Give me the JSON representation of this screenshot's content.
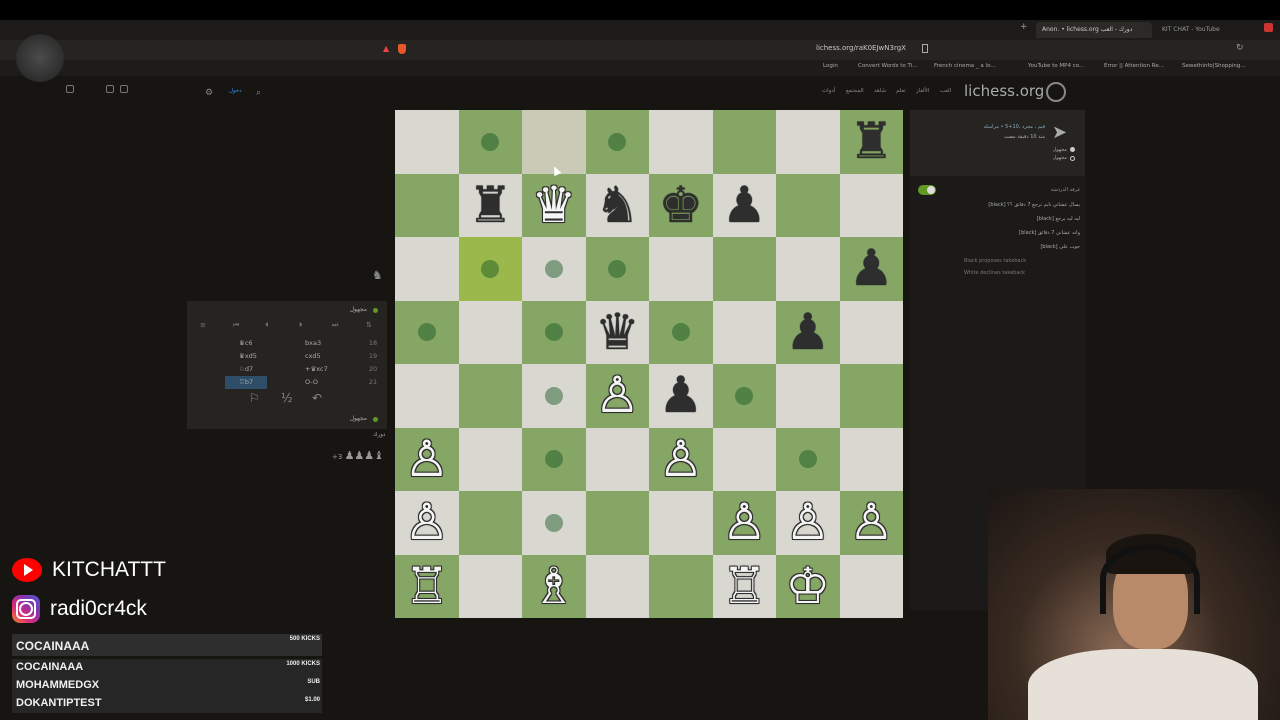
{
  "browser": {
    "tabs": [
      {
        "label": "Anon. • lichess.org دورك - العب",
        "active": true
      },
      {
        "label": "KIT CHAT - YouTube",
        "active": false
      }
    ],
    "url": "lichess.org/raK0EJwN3rgX",
    "bookmarks": [
      "Login",
      "Convert Words to Ti...",
      "French cinema _ a lo...",
      "YouTube to MP4 co...",
      "Error || Attention Re...",
      "Sewethinfo|Shopping..."
    ]
  },
  "lichess": {
    "logo": "lichess.org",
    "nav": [
      "العب",
      "الألغاز",
      "تعلم",
      "شاهد",
      "المجتمع",
      "أدوات"
    ],
    "signin": "دخول"
  },
  "board": {
    "pieces": [
      {
        "sq": "h8",
        "glyph": "♜",
        "color": "black"
      },
      {
        "sq": "b7",
        "glyph": "♜",
        "color": "black"
      },
      {
        "sq": "c7",
        "glyph": "♛",
        "color": "white"
      },
      {
        "sq": "d7",
        "glyph": "♞",
        "color": "black"
      },
      {
        "sq": "e7",
        "glyph": "♚",
        "color": "black"
      },
      {
        "sq": "f7",
        "glyph": "♟",
        "color": "black"
      },
      {
        "sq": "h6",
        "glyph": "♟",
        "color": "black"
      },
      {
        "sq": "d5",
        "glyph": "♛",
        "color": "black"
      },
      {
        "sq": "g5",
        "glyph": "♟",
        "color": "black"
      },
      {
        "sq": "d4",
        "glyph": "♙",
        "color": "white"
      },
      {
        "sq": "e4",
        "glyph": "♟",
        "color": "black"
      },
      {
        "sq": "a3",
        "glyph": "♙",
        "color": "white"
      },
      {
        "sq": "e3",
        "glyph": "♙",
        "color": "white"
      },
      {
        "sq": "a2",
        "glyph": "♙",
        "color": "white"
      },
      {
        "sq": "f2",
        "glyph": "♙",
        "color": "white"
      },
      {
        "sq": "g2",
        "glyph": "♙",
        "color": "white"
      },
      {
        "sq": "h2",
        "glyph": "♙",
        "color": "white"
      },
      {
        "sq": "a1",
        "glyph": "♖",
        "color": "white"
      },
      {
        "sq": "c1",
        "glyph": "♗",
        "color": "white"
      },
      {
        "sq": "f1",
        "glyph": "♖",
        "color": "white"
      },
      {
        "sq": "g1",
        "glyph": "♔",
        "color": "white"
      }
    ],
    "dots": [
      "b8",
      "d8",
      "b6",
      "c6",
      "d6",
      "a5",
      "c5",
      "e5",
      "c4",
      "f4",
      "c3",
      "g3",
      "c2"
    ],
    "last_move": [
      "c8",
      "b6"
    ]
  },
  "move_panel": {
    "top_player": "مجهول",
    "bottom_player": "مجهول",
    "bottom_status": "دورك",
    "material": "+3",
    "material_icons": "♟♟♟♝",
    "moves": [
      {
        "num": "18",
        "black": "bxa3",
        "white": "♛c6"
      },
      {
        "num": "19",
        "black": "cxd5",
        "white": "♛xd5"
      },
      {
        "num": "20",
        "black": "+♛xc7",
        "white": "♘d7"
      },
      {
        "num": "21",
        "black": "O-O",
        "white": "♖b7"
      }
    ],
    "half_label": "½"
  },
  "chat": {
    "game_type": "قيم ، مجرد ،10+5 • مراسلة",
    "game_time": "منذ 10 دقيقة مضت",
    "player_white": "مجهول",
    "player_black": "مجهول",
    "room_label": "غرفة الدردشة",
    "messages": [
      {
        "name": "[black]",
        "text": "يسال عشاني نايم ترجع 7 دقائق ؟؟"
      },
      {
        "name": "[black]",
        "text": "ليه ليه يرجع"
      },
      {
        "name": "[black]",
        "text": "وانه عشاني 7 دقائق"
      },
      {
        "name": "[black]",
        "text": "جوب علي"
      }
    ],
    "system": [
      "Black proposes takeback",
      "White declines takeback"
    ]
  },
  "overlay": {
    "youtube": "KITCHATTT",
    "instagram": "radi0cr4ck",
    "donations": [
      {
        "name": "COCAINAAA",
        "amount": "500 KICKS",
        "top": true
      },
      {
        "name": "COCAINAAA",
        "amount": "1000 KICKS",
        "top": false
      },
      {
        "name": "MOHAMMEDGX",
        "amount": "SUB",
        "top": false
      },
      {
        "name": "DOKANTIPTEST",
        "amount": "$1.00",
        "top": false
      }
    ]
  },
  "colors": {
    "light_square": "#d8d8d0",
    "dark_square": "#86a666",
    "selected": "#9ab84b",
    "youtube_red": "#ff0000"
  }
}
